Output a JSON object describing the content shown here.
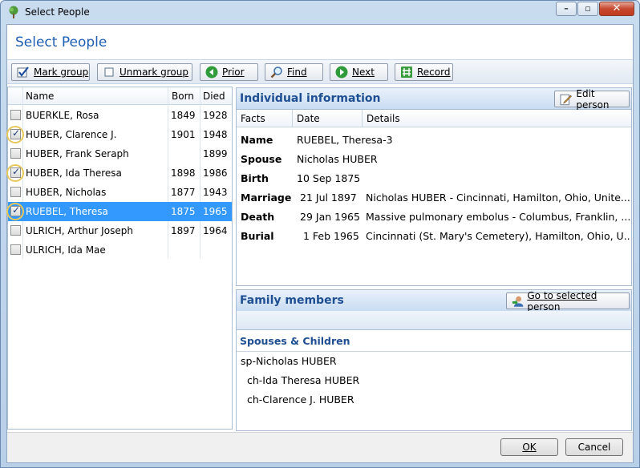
{
  "window": {
    "title": "Select People"
  },
  "page": {
    "title": "Select People"
  },
  "toolbar": {
    "mark_group": "Mark group",
    "unmark_group": "Unmark group",
    "prior": "Prior",
    "find": "Find",
    "next": "Next",
    "record": "Record"
  },
  "grid": {
    "headers": {
      "name": "Name",
      "born": "Born",
      "died": "Died"
    },
    "rows": [
      {
        "name": "BUERKLE, Rosa",
        "born": "1849",
        "died": "1928",
        "checked": false,
        "selected": false
      },
      {
        "name": "HUBER, Clarence J.",
        "born": "1901",
        "died": "1948",
        "checked": true,
        "selected": false
      },
      {
        "name": "HUBER, Frank Seraph",
        "born": "",
        "died": "1899",
        "checked": false,
        "selected": false
      },
      {
        "name": "HUBER, Ida Theresa",
        "born": "1898",
        "died": "1986",
        "checked": true,
        "selected": false
      },
      {
        "name": "HUBER, Nicholas",
        "born": "1877",
        "died": "1943",
        "checked": false,
        "selected": false
      },
      {
        "name": "RUEBEL, Theresa",
        "born": "1875",
        "died": "1965",
        "checked": true,
        "selected": true
      },
      {
        "name": "ULRICH, Arthur Joseph",
        "born": "1897",
        "died": "1964",
        "checked": false,
        "selected": false
      },
      {
        "name": "ULRICH, Ida Mae",
        "born": "",
        "died": "",
        "checked": false,
        "selected": false
      }
    ]
  },
  "info": {
    "title": "Individual information",
    "edit_button": "Edit person",
    "headers": {
      "facts": "Facts",
      "date": "Date",
      "details": "Details"
    },
    "rows": [
      {
        "fact": "Name",
        "date": "RUEBEL, Theresa-3",
        "details": ""
      },
      {
        "fact": "Spouse",
        "date": "Nicholas HUBER",
        "details": ""
      },
      {
        "fact": "Birth",
        "date": "10 Sep 1875",
        "details": ""
      },
      {
        "fact": "Marriage",
        "date": "21 Jul 1897",
        "details": "Nicholas HUBER - Cincinnati, Hamilton, Ohio, Unite..."
      },
      {
        "fact": "Death",
        "date": "29 Jan 1965",
        "details": "Massive pulmonary embolus - Columbus, Franklin, ..."
      },
      {
        "fact": "Burial",
        "date": "1 Feb 1965",
        "details": "Cincinnati (St. Mary's Cemetery), Hamilton, Ohio, U..."
      }
    ]
  },
  "family": {
    "title": "Family members",
    "goto_button": "Go to selected person",
    "group": "Spouses & Children",
    "items": [
      {
        "label": "sp-Nicholas HUBER",
        "indent": 0
      },
      {
        "label": "ch-Ida Theresa HUBER",
        "indent": 1
      },
      {
        "label": "ch-Clarence J. HUBER",
        "indent": 1
      }
    ]
  },
  "footer": {
    "ok": "OK",
    "cancel": "Cancel"
  },
  "colors": {
    "accent": "#1e5fb3",
    "selection": "#3399ff",
    "panel_title": "#1e4f93"
  }
}
